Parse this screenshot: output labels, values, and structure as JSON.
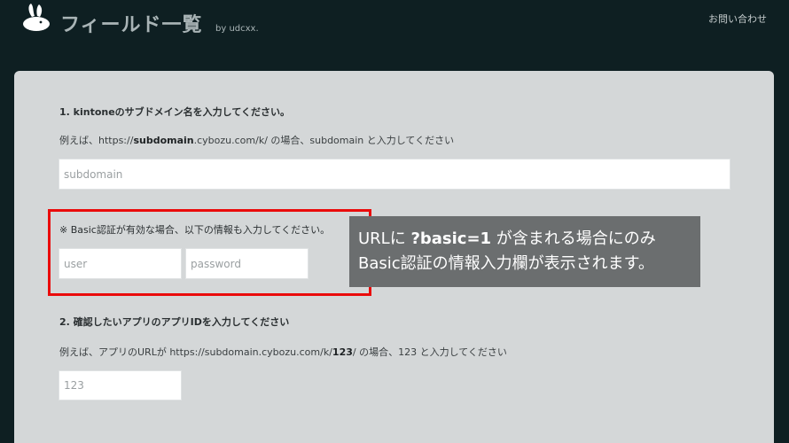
{
  "header": {
    "title": "フィールド一覧",
    "by": "by udcxx.",
    "contact": "お問い合わせ"
  },
  "section1": {
    "heading": "1. kintoneのサブドメイン名を入力してください。",
    "example_prefix": "例えば、https://",
    "example_bold": "subdomain",
    "example_suffix": ".cybozu.com/k/ の場合、subdomain と入力してください",
    "subdomain_placeholder": "subdomain"
  },
  "basic": {
    "note": "※ Basic認証が有効な場合、以下の情報も入力してください。",
    "user_placeholder": "user",
    "password_placeholder": "password"
  },
  "callout": {
    "line1_prefix": "URLに ",
    "line1_bold": "?basic=1",
    "line1_suffix": " が含まれる場合にのみ",
    "line2": "Basic認証の情報入力欄が表示されます。"
  },
  "section2": {
    "heading": "2. 確認したいアプリのアプリIDを入力してください",
    "example_prefix": "例えば、アプリのURLが https://subdomain.cybozu.com/k/",
    "example_bold": "123",
    "example_suffix": "/ の場合、123 と入力してください",
    "appid_placeholder": "123"
  },
  "colors": {
    "background": "#0e1f22",
    "panel": "#d4d7d8",
    "highlight": "#ea0b0b",
    "callout": "#6b6e6f"
  }
}
